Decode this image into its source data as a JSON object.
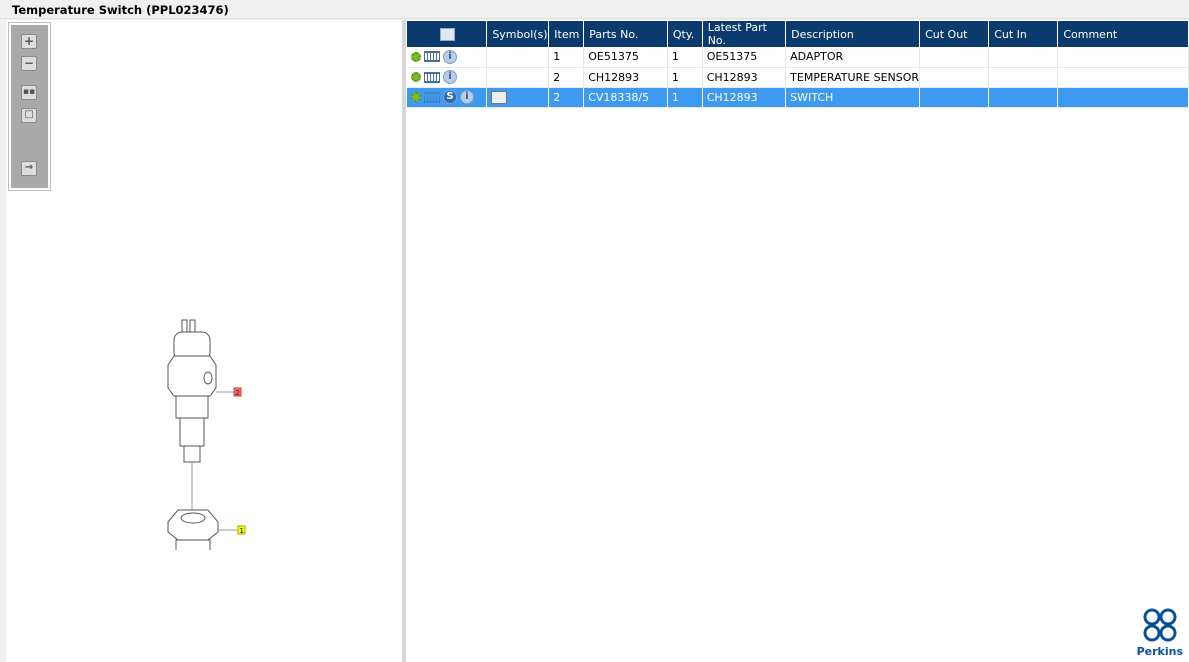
{
  "title": "Temperature Switch (PPL023476)",
  "toolbar": {
    "items": [
      "zoom-in",
      "zoom-out",
      "fit-all",
      "fit-window",
      "export"
    ]
  },
  "drawing": {
    "callouts": [
      "1",
      "2"
    ],
    "callout_colors": {
      "1": "#ffff00",
      "2": "#f07070"
    }
  },
  "table": {
    "headers": [
      "",
      "Symbol(s)",
      "Item",
      "Parts No.",
      "Qty.",
      "Latest Part No.",
      "Description",
      "Cut Out",
      "Cut In",
      "Comment"
    ],
    "rows": [
      {
        "item": "1",
        "parts_no": "OE51375",
        "qty": "1",
        "latest": "OE51375",
        "description": "ADAPTOR",
        "cut_out": "",
        "cut_in": "",
        "comment": "",
        "selected": false
      },
      {
        "item": "2",
        "parts_no": "CH12893",
        "qty": "1",
        "latest": "CH12893",
        "description": "TEMPERATURE SENSOR",
        "cut_out": "",
        "cut_in": "",
        "comment": "",
        "selected": false
      },
      {
        "item": "2",
        "parts_no": "CV18338/5",
        "qty": "1",
        "latest": "CH12893",
        "description": "SWITCH",
        "cut_out": "",
        "cut_in": "",
        "comment": "",
        "selected": true
      }
    ],
    "info_glyph": "i",
    "symbol_glyph": "S"
  },
  "brand": {
    "name": "Perkins",
    "color": "#0a4f9c"
  },
  "colors": {
    "header": "#0b3a6e",
    "selected": "#3d9af0"
  }
}
